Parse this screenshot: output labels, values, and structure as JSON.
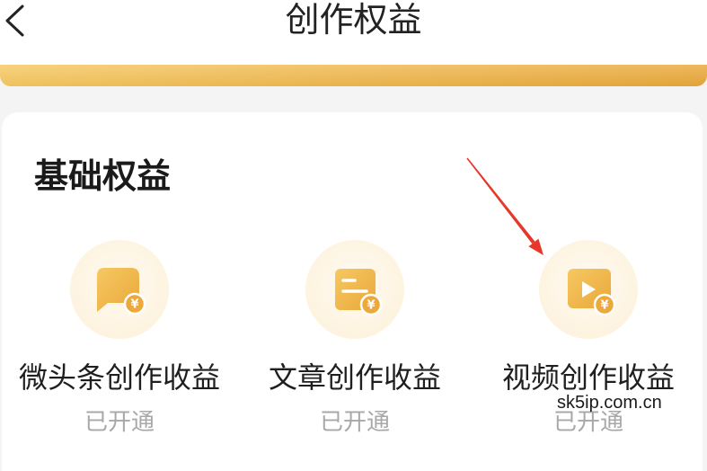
{
  "header": {
    "back_icon": "chevron-left-icon",
    "title": "创作权益"
  },
  "section": {
    "title": "基础权益",
    "items": [
      {
        "label": "微头条创作收益",
        "status": "已开通",
        "icon": "chat-bubble-yen-icon"
      },
      {
        "label": "文章创作收益",
        "status": "已开通",
        "icon": "document-yen-icon"
      },
      {
        "label": "视频创作收益",
        "status": "已开通",
        "icon": "video-yen-icon"
      }
    ]
  },
  "coin_symbol": "¥",
  "watermark": "sk5ip.com.cn",
  "colors": {
    "gold_light": "#f6c862",
    "gold_dark": "#e9a83a",
    "icon_bg": "#fdf3df",
    "label_text": "#1f1f1f",
    "status_text": "#a8a8a8",
    "annotation_red": "#e5382b"
  }
}
